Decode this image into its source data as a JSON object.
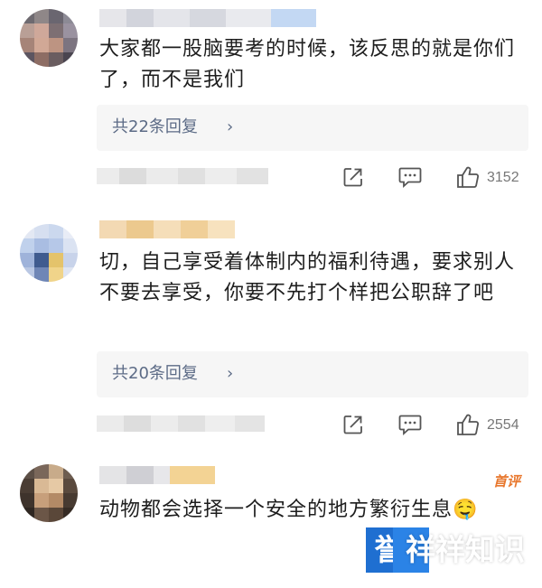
{
  "comments": [
    {
      "text": "大家都一股脑要考的时候，该反思的就是你们了，而不是我们",
      "replies_label": "共22条回复",
      "chevron": "›",
      "likes": "3152"
    },
    {
      "text": "切，自己享受着体制内的福利待遇，要求别人不要去享受，你要不先打个样把公职辞了吧",
      "replies_label": "共20条回复",
      "chevron": "›",
      "likes": "2554"
    },
    {
      "text": "动物都会选择一个安全的地方繁衍生息🤤",
      "badge": "首评"
    }
  ],
  "icons": {
    "share": "share-icon",
    "comment": "comment-icon",
    "like": "thumbs-up-icon"
  },
  "colors": {
    "reply_link": "#5c6b86",
    "badge": "#e8772d",
    "watermark_blue": "#1f6fd1"
  },
  "watermark": {
    "tile_char": "誉",
    "text": "祥祥知识"
  }
}
